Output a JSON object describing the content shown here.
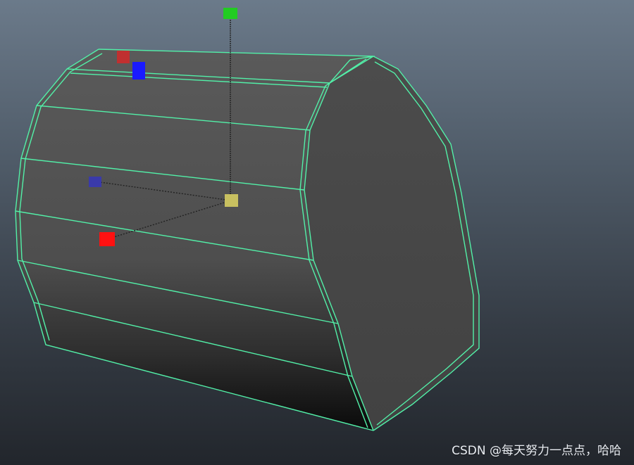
{
  "viewport": {
    "background_top": "#6b7a8a",
    "background_bottom": "#22262c"
  },
  "object": {
    "wireframe_color": "#52f0a8",
    "face_color": "#4a4a4a",
    "cap_color": "#464646",
    "shadow_color": "#111111"
  },
  "manipulator": {
    "x_handle_color": "#ff1111",
    "y_handle_color": "#22cc22",
    "z_handle_color": "#3a3aaa",
    "center_color": "#c8c060",
    "secondary_red_color": "#c03030",
    "secondary_blue_color": "#1a1aff"
  },
  "watermark": {
    "text": "CSDN @每天努力一点点，哈哈"
  }
}
